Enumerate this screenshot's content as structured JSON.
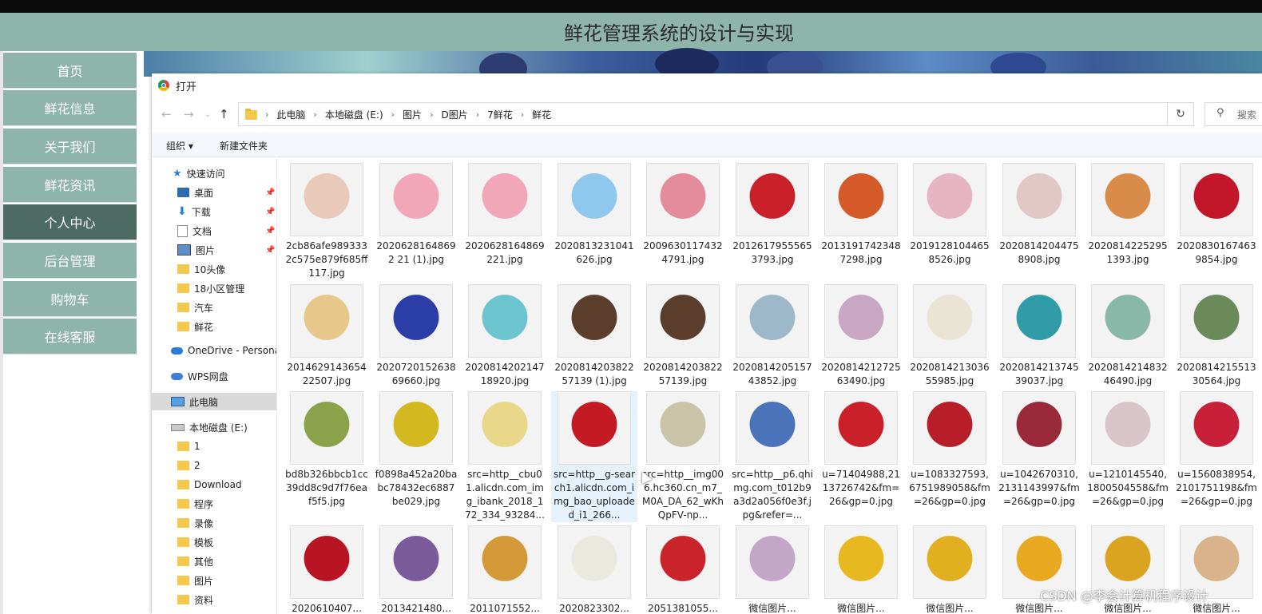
{
  "app": {
    "title": "鲜花管理系统的设计与实现"
  },
  "nav": {
    "items": [
      {
        "label": "首页",
        "active": false
      },
      {
        "label": "鲜花信息",
        "active": false
      },
      {
        "label": "关于我们",
        "active": false
      },
      {
        "label": "鲜花资讯",
        "active": false
      },
      {
        "label": "个人中心",
        "active": true
      },
      {
        "label": "后台管理",
        "active": false
      },
      {
        "label": "购物车",
        "active": false
      },
      {
        "label": "在线客服",
        "active": false
      }
    ]
  },
  "dialog": {
    "title": "打开",
    "breadcrumbs": [
      "此电脑",
      "本地磁盘 (E:)",
      "图片",
      "D图片",
      "7鲜花",
      "鲜花"
    ],
    "search_placeholder": "搜索",
    "toolbar": {
      "organize": "组织 ▾",
      "new_folder": "新建文件夹"
    }
  },
  "navpane": {
    "items": [
      {
        "label": "快速访问",
        "icon": "star-icon",
        "pinned": false
      },
      {
        "label": "桌面",
        "icon": "desktop-icon",
        "pinned": true
      },
      {
        "label": "下载",
        "icon": "download-icon",
        "pinned": true
      },
      {
        "label": "文档",
        "icon": "document-icon",
        "pinned": true
      },
      {
        "label": "图片",
        "icon": "picture-icon",
        "pinned": true
      },
      {
        "label": "10头像",
        "icon": "folder-icon",
        "pinned": false
      },
      {
        "label": "18小区管理",
        "icon": "folder-icon",
        "pinned": false
      },
      {
        "label": "汽车",
        "icon": "folder-icon",
        "pinned": false
      },
      {
        "label": "鲜花",
        "icon": "folder-icon",
        "pinned": false
      },
      {
        "label": "OneDrive - Persona",
        "icon": "cloud-icon",
        "pinned": false
      },
      {
        "label": "WPS网盘",
        "icon": "cloud-icon",
        "pinned": false
      },
      {
        "label": "此电脑",
        "icon": "computer-icon",
        "pinned": false,
        "selected": true
      },
      {
        "label": "本地磁盘 (E:)",
        "icon": "drive-icon",
        "pinned": false
      },
      {
        "label": "1",
        "icon": "folder-icon",
        "pinned": false
      },
      {
        "label": "2",
        "icon": "folder-icon",
        "pinned": false
      },
      {
        "label": "Download",
        "icon": "folder-icon",
        "pinned": false
      },
      {
        "label": "程序",
        "icon": "folder-icon",
        "pinned": false
      },
      {
        "label": "录像",
        "icon": "folder-icon",
        "pinned": false
      },
      {
        "label": "模板",
        "icon": "folder-icon",
        "pinned": false
      },
      {
        "label": "其他",
        "icon": "folder-icon",
        "pinned": false
      },
      {
        "label": "图片",
        "icon": "folder-icon",
        "pinned": false
      },
      {
        "label": "资料",
        "icon": "folder-icon",
        "pinned": false
      }
    ]
  },
  "files": {
    "rows": [
      [
        {
          "name": "2cb86afe9893332c575e879f685ff117.jpg",
          "color": "#e9c9b8"
        },
        {
          "name": "20206281648692 21 (1).jpg",
          "color": "#f2a6b9"
        },
        {
          "name": "2020628164869221.jpg",
          "color": "#f2a6b9"
        },
        {
          "name": "2020813231041626.jpg",
          "color": "#8fc8ef"
        },
        {
          "name": "20096301174324791.jpg",
          "color": "#e48c9c"
        },
        {
          "name": "20126179555653793.jpg",
          "color": "#c9202a"
        },
        {
          "name": "20131917423487298.jpg",
          "color": "#d45a2a"
        },
        {
          "name": "20191281044658526.jpg",
          "color": "#e7b4c4"
        },
        {
          "name": "20208142044758908.jpg",
          "color": "#e2c7c7"
        },
        {
          "name": "20208142252951393.jpg",
          "color": "#d98c4a"
        },
        {
          "name": "20208301674639854.jpg",
          "color": "#c3162a"
        }
      ],
      [
        {
          "name": "201462914365422507.jpg",
          "color": "#e8c88a"
        },
        {
          "name": "202072015263869660.jpg",
          "color": "#2b3ea8"
        },
        {
          "name": "202081420214718920.jpg",
          "color": "#6cc4cf"
        },
        {
          "name": "202081420382257139 (1).jpg",
          "color": "#5a3d2a"
        },
        {
          "name": "202081420382257139.jpg",
          "color": "#5a3d2a"
        },
        {
          "name": "202081420515743852.jpg",
          "color": "#9db9c9"
        },
        {
          "name": "202081421272563490.jpg",
          "color": "#c9a6c4"
        },
        {
          "name": "202081421303655985.jpg",
          "color": "#e9e4d4"
        },
        {
          "name": "202081421374539037.jpg",
          "color": "#2f9ca8"
        },
        {
          "name": "202081421483246490.jpg",
          "color": "#8ab8a8"
        },
        {
          "name": "202081421551330564.jpg",
          "color": "#6a8a5a"
        }
      ],
      [
        {
          "name": "bd8b326bbcb1cc39dd8c9d7f76eaf5f5.jpg",
          "color": "#8ca24a"
        },
        {
          "name": "f0898a452a20babc78432ec6887be029.jpg",
          "color": "#d4b820"
        },
        {
          "name": "src=http__cbu01.alicdn.com_img_ibank_2018_172_334_93284...",
          "color": "#e9d88a"
        },
        {
          "name": "src=http__g-search1.alicdn.com_img_bao_uploaded_i1_266...",
          "color": "#c41a24",
          "selected": true
        },
        {
          "name": "src=http__img006.hc360.cn_m7_M0A_DA_62_wKhQpFV-np...",
          "color": "#c9c3a8"
        },
        {
          "name": "src=http__p6.qhimg.com_t012b9a3d2a056f0e3f.jpg&refer=...",
          "color": "#4a73b9"
        },
        {
          "name": "u=71404988,2113726742&fm=26&gp=0.jpg",
          "color": "#c9202a"
        },
        {
          "name": "u=1083327593,6751989058&fm=26&gp=0.jpg",
          "color": "#b81d2a"
        },
        {
          "name": "u=1042670310,2131143997&fm=26&gp=0.jpg",
          "color": "#9a2a3a"
        },
        {
          "name": "u=1210145540,1800504558&fm=26&gp=0.jpg",
          "color": "#d9c4c9"
        },
        {
          "name": "u=1560838954,2101751198&fm=26&gp=0.jpg",
          "color": "#c9203a"
        }
      ],
      [
        {
          "name": "2020610407...",
          "color": "#b81424"
        },
        {
          "name": "2013421480...",
          "color": "#7a5a9a"
        },
        {
          "name": "2011071552...",
          "color": "#d49a3a"
        },
        {
          "name": "2020823302...",
          "color": "#e9e9e0"
        },
        {
          "name": "2051381055...",
          "color": "#c9242a"
        },
        {
          "name": "微信图片...",
          "color": "#c4a6c9"
        },
        {
          "name": "微信图片...",
          "color": "#e8b820"
        },
        {
          "name": "微信图片...",
          "color": "#e0b020"
        },
        {
          "name": "微信图片...",
          "color": "#e8a820"
        },
        {
          "name": "微信图片...",
          "color": "#dba420"
        },
        {
          "name": "微信图片...",
          "color": "#d9b48a"
        }
      ]
    ]
  },
  "watermark": "CSDN @李会计算机程序设计"
}
